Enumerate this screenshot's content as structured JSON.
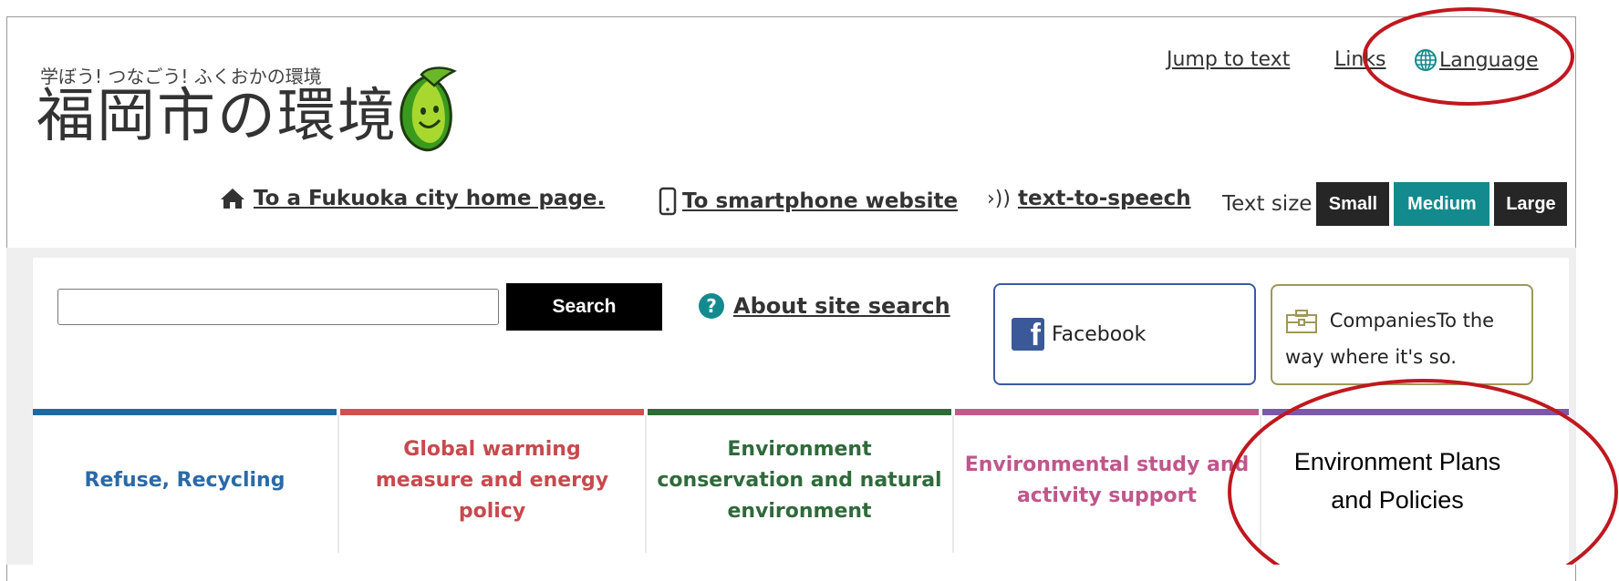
{
  "header": {
    "tagline": "学ぼう! つなごう! ふくおかの環境",
    "site_title": "福岡市の環境",
    "top_links": {
      "jump_to_text": "Jump to text",
      "links": "Links",
      "language": "Language"
    },
    "row_links": {
      "home": "To a Fukuoka city home page.",
      "smartphone": "To smartphone website",
      "tts": "text-to-speech",
      "text_size_label": "Text size",
      "text_size_options": [
        "Small",
        "Medium",
        "Large"
      ]
    }
  },
  "search": {
    "value": "",
    "button_label": "Search",
    "about_label": "About site search"
  },
  "banners": {
    "facebook": "Facebook",
    "companies": "CompaniesTo the way where it's so."
  },
  "categories": [
    {
      "label": "Refuse, Recycling",
      "color": "#1e6a9e"
    },
    {
      "label": "Global warming measure and energy policy",
      "color": "#d05050"
    },
    {
      "label": "Environment conservation and natural environment",
      "color": "#2f6a38"
    },
    {
      "label": "Environmental study and activity support",
      "color": "#c05b8c"
    },
    {
      "label": "Environment Plans and Policies",
      "color": "#7a5aa8"
    }
  ],
  "colors": {
    "accent_teal": "#138a8e",
    "annotation_red": "#c0181f"
  }
}
